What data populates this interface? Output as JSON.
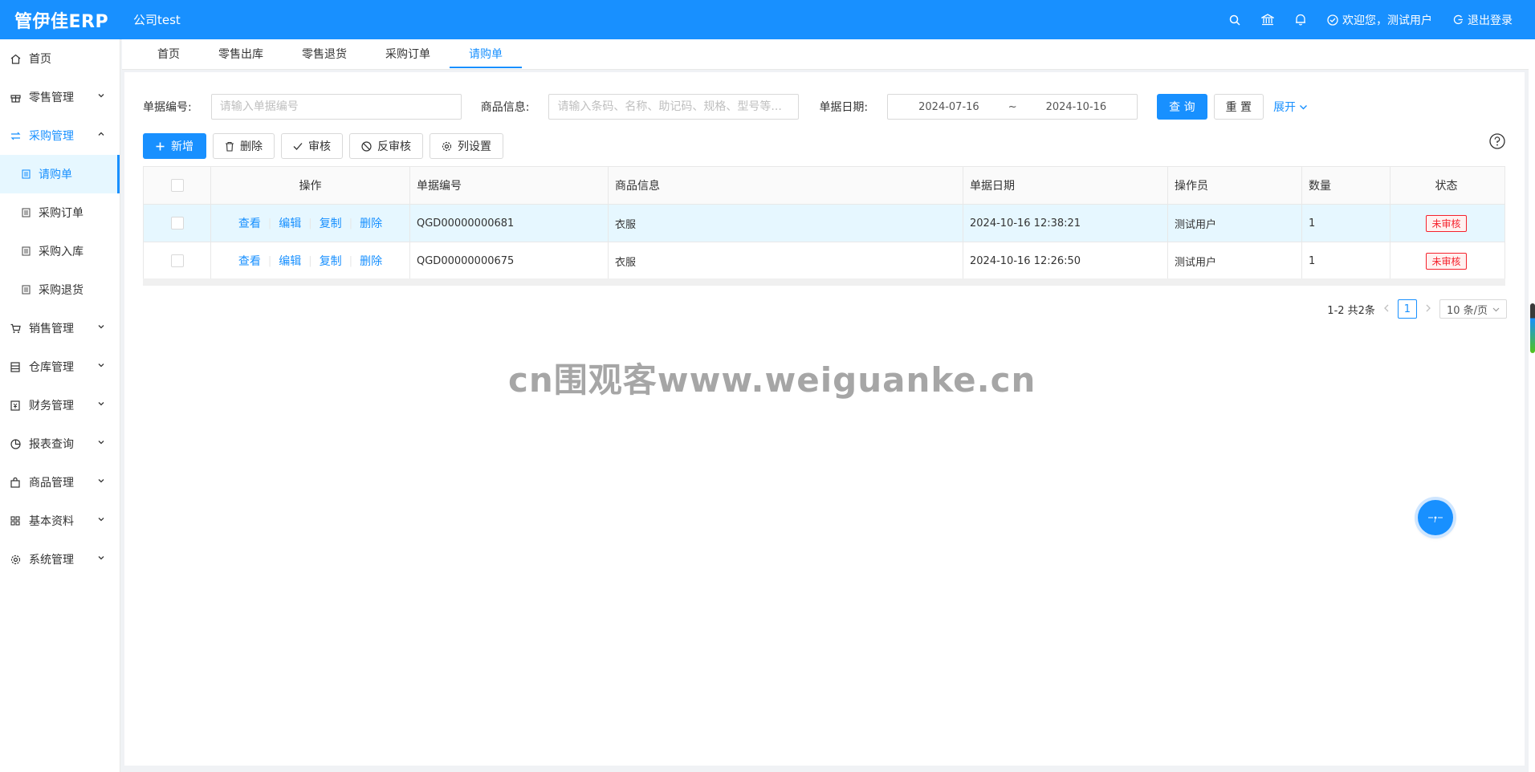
{
  "header": {
    "logo": "管伊佳ERP",
    "company": "公司test",
    "welcome": "欢迎您，测试用户",
    "logout": "退出登录"
  },
  "sidebar": {
    "items": [
      {
        "label": "首页",
        "icon": "home-icon"
      },
      {
        "label": "零售管理",
        "icon": "gift-icon"
      },
      {
        "label": "采购管理",
        "icon": "swap-icon",
        "expanded": true
      },
      {
        "label": "销售管理",
        "icon": "cart-icon"
      },
      {
        "label": "仓库管理",
        "icon": "warehouse-icon"
      },
      {
        "label": "财务管理",
        "icon": "finance-icon"
      },
      {
        "label": "报表查询",
        "icon": "pie-chart-icon"
      },
      {
        "label": "商品管理",
        "icon": "bag-icon"
      },
      {
        "label": "基本资料",
        "icon": "grid-icon"
      },
      {
        "label": "系统管理",
        "icon": "settings-icon"
      }
    ],
    "sub_items": [
      {
        "label": "请购单",
        "active": true
      },
      {
        "label": "采购订单"
      },
      {
        "label": "采购入库"
      },
      {
        "label": "采购退货"
      }
    ]
  },
  "tabs": [
    "首页",
    "零售出库",
    "零售退货",
    "采购订单",
    "请购单"
  ],
  "filter": {
    "bill_no_label": "单据编号:",
    "bill_no_placeholder": "请输入单据编号",
    "goods_label": "商品信息:",
    "goods_placeholder": "请输入条码、名称、助记码、规格、型号等...",
    "date_label": "单据日期:",
    "date_start": "2024-07-16",
    "date_sep": "~",
    "date_end": "2024-10-16",
    "search": "查 询",
    "reset": "重 置",
    "expand": "展开"
  },
  "toolbar": {
    "add": "新增",
    "delete": "删除",
    "audit": "审核",
    "unaudit": "反审核",
    "columns": "列设置"
  },
  "table": {
    "columns": [
      "操作",
      "单据编号",
      "商品信息",
      "单据日期",
      "操作员",
      "数量",
      "状态"
    ],
    "actions": [
      "查看",
      "编辑",
      "复制",
      "删除"
    ],
    "rows": [
      {
        "bill_no": "QGD00000000681",
        "goods": "衣服",
        "date": "2024-10-16 12:38:21",
        "operator": "测试用户",
        "qty": "1",
        "status": "未审核"
      },
      {
        "bill_no": "QGD00000000675",
        "goods": "衣服",
        "date": "2024-10-16 12:26:50",
        "operator": "测试用户",
        "qty": "1",
        "status": "未审核"
      }
    ]
  },
  "pagination": {
    "summary": "1-2 共2条",
    "current": "1",
    "page_size": "10 条/页"
  },
  "watermark": "cn围观客www.weiguanke.cn",
  "colors": {
    "primary": "#1890ff",
    "danger": "#f5222d",
    "highlight_row": "#e6f7ff"
  }
}
